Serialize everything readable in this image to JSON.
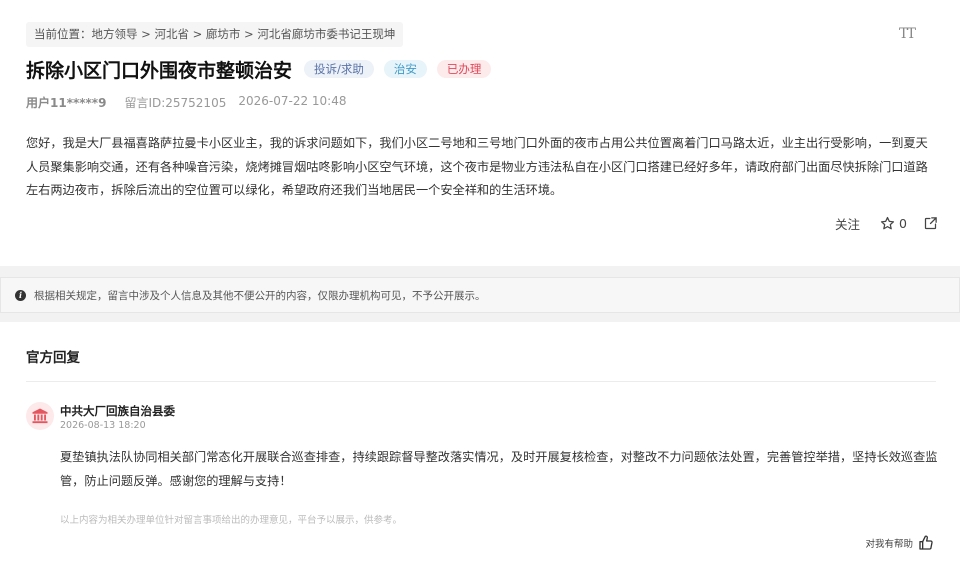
{
  "breadcrumb": {
    "text": "当前位置：地方领导 > 河北省 > 廊坊市 > 河北省廊坊市委书记王现坤"
  },
  "font_size_label": "TT",
  "message": {
    "title": "拆除小区门口外围夜市整顿治安",
    "tag_type": "投诉/求助",
    "tag_category": "治安",
    "tag_status": "已办理",
    "user": "用户11*****9",
    "message_id": "留言ID:25752105",
    "time": "2026-07-22 10:48",
    "content": "您好，我是大厂县福喜路萨拉曼卡小区业主，我的诉求问题如下，我们小区二号地和三号地门口外面的夜市占用公共位置离着门口马路太近，业主出行受影响，一到夏天人员聚集影响交通，还有各种噪音污染，烧烤摊冒烟咕咚影响小区空气环境，这个夜市是物业方违法私自在小区门口搭建已经好多年，请政府部门出面尽快拆除门口道路左右两边夜市，拆除后流出的空位置可以绿化，希望政府还我们当地居民一个安全祥和的生活环境。"
  },
  "actions": {
    "follow_label": "关注",
    "star_count": "0"
  },
  "notice": {
    "text": "根据相关规定，留言中涉及个人信息及其他不便公开的内容，仅限办理机构可见，不予公开展示。"
  },
  "official_reply": {
    "section_title": "官方回复",
    "org_name": "中共大厂回族自治县委",
    "time": "2026-08-13 18:20",
    "content": "夏垫镇执法队协同相关部门常态化开展联合巡查排查，持续跟踪督导整改落实情况，及时开展复核检查，对整改不力问题依法处置，完善管控举措，坚持长效巡查监管，防止问题反弹。感谢您的理解与支持！",
    "disclaimer": "以上内容为相关办理单位针对留言事项给出的办理意见，平台予以展示，供参考。",
    "helpful_label": "对我有帮助"
  },
  "colors": {
    "status_red": "#e0495a",
    "category_blue": "#3f9ac9",
    "type_blue": "#5a74a8",
    "org_icon_red": "#e5575f"
  }
}
